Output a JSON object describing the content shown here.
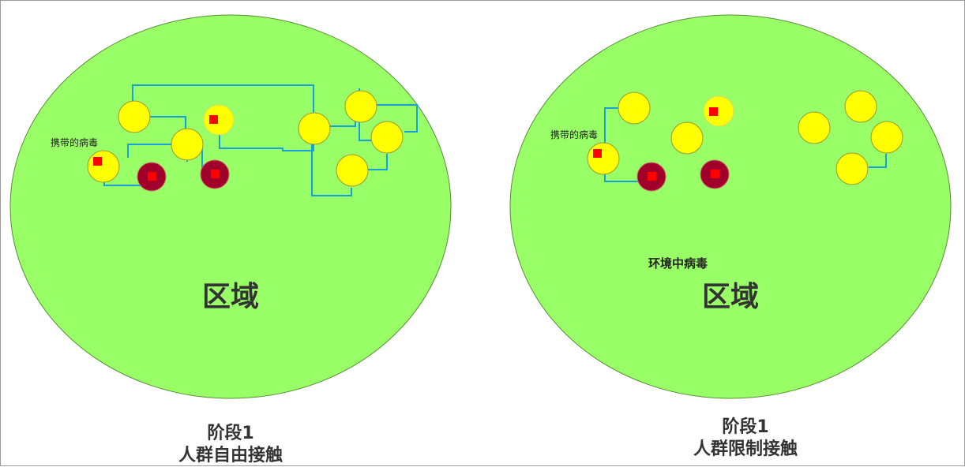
{
  "panels": [
    {
      "carrier_label": "携带的病毒",
      "region_label": "区域",
      "stage": "阶段1",
      "mode": "人群自由接触"
    },
    {
      "carrier_label": "携带的病毒",
      "environment_label": "环境中病毒",
      "region_label": "区域",
      "stage": "阶段1",
      "mode": "人群限制接触"
    }
  ],
  "colors": {
    "region": "#99ff66",
    "person": "#ffff00",
    "infected_person": "#a0002a",
    "virus": "#ff0000",
    "contact_path": "#1aa0d8"
  }
}
